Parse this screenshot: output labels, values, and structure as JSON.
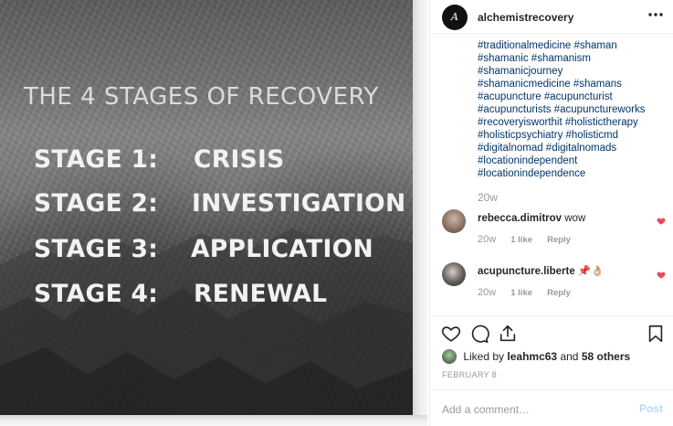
{
  "image": {
    "title": "THE 4 STAGES OF RECOVERY",
    "stages": [
      {
        "label": "STAGE 1:",
        "name": "CRISIS"
      },
      {
        "label": "STAGE 2:",
        "name": "INVESTIGATION"
      },
      {
        "label": "STAGE 3:",
        "name": "APPLICATION"
      },
      {
        "label": "STAGE 4:",
        "name": "RENEWAL"
      }
    ]
  },
  "header": {
    "avatar_text": "A",
    "username": "alchemistrecovery",
    "more_icon": "ellipsis-icon"
  },
  "caption": {
    "lines": [
      "#traditionalmedicine #shaman",
      "#shamanic #shamanism",
      "#shamanicjourney",
      "#shamanicmedicine #shamans",
      "#acupuncture #acupuncturist",
      "#acupuncturists #acupunctureworks",
      "#recoveryisworthit #holistictherapy",
      "#holisticpsychiatry #holisticmd",
      "#digitalnomad #digitalnomads",
      "#locationindependent",
      "#locationindependence"
    ],
    "time": "20w"
  },
  "comments": [
    {
      "user": "rebecca.dimitrov",
      "text": "wow",
      "time": "20w",
      "likes": "1 like",
      "reply": "Reply"
    },
    {
      "user": "acupuncture.liberte",
      "text": "📌👌🏼",
      "time": "20w",
      "likes": "1 like",
      "reply": "Reply"
    }
  ],
  "actions": {
    "liked_prefix": "Liked by",
    "liked_user": "leahmc63",
    "liked_and": "and",
    "liked_others": "58 others",
    "date": "FEBRUARY 8"
  },
  "add_comment": {
    "placeholder": "Add a comment…",
    "post_label": "Post"
  },
  "colors": {
    "heart": "#ed4956",
    "hashtag": "#003569",
    "post_button": "#b3dbff"
  }
}
